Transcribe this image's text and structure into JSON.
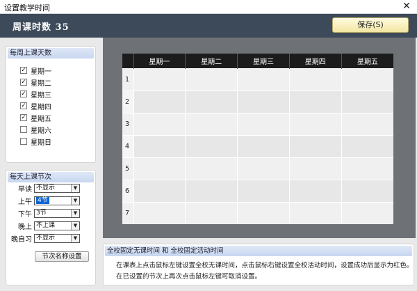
{
  "window": {
    "title": "设置教学时间",
    "close_glyph": "✕"
  },
  "header": {
    "hours_label": "周课时数  35",
    "save_label": "保存(S)"
  },
  "days_panel": {
    "title": "每周上课天数",
    "days": [
      {
        "label": "星期一",
        "checked": true
      },
      {
        "label": "星期二",
        "checked": true
      },
      {
        "label": "星期三",
        "checked": true
      },
      {
        "label": "星期四",
        "checked": true
      },
      {
        "label": "星期五",
        "checked": true
      },
      {
        "label": "星期六",
        "checked": false
      },
      {
        "label": "星期日",
        "checked": false
      }
    ]
  },
  "periods_panel": {
    "title": "每天上课节次",
    "rows": [
      {
        "label": "早读",
        "value": "不显示"
      },
      {
        "label": "上午",
        "value": "4节"
      },
      {
        "label": "下午",
        "value": "3节"
      },
      {
        "label": "晚上",
        "value": "不上课"
      },
      {
        "label": "晚自习",
        "value": "不显示"
      }
    ],
    "name_button": "节次名称设置"
  },
  "timetable": {
    "headers": [
      "星期一",
      "星期二",
      "星期三",
      "星期四",
      "星期五"
    ],
    "rows": [
      "1",
      "2",
      "3",
      "4",
      "5",
      "6",
      "7"
    ]
  },
  "info": {
    "title": "全校固定无课时间 和 全校固定活动时间",
    "line1": "在课表上点击鼠标左键设置全校无课时间，点击鼠标右键设置全校活动时间，设置成功后显示为红色。",
    "line2": "在已设置的节次上再次点击鼠标左键可取消设置。"
  },
  "colors": {
    "header_bg": "#3c4a59",
    "grid_bg": "#6e7276",
    "selected_bg": "#0a64d8",
    "save_bg": "#f3e6a2"
  }
}
